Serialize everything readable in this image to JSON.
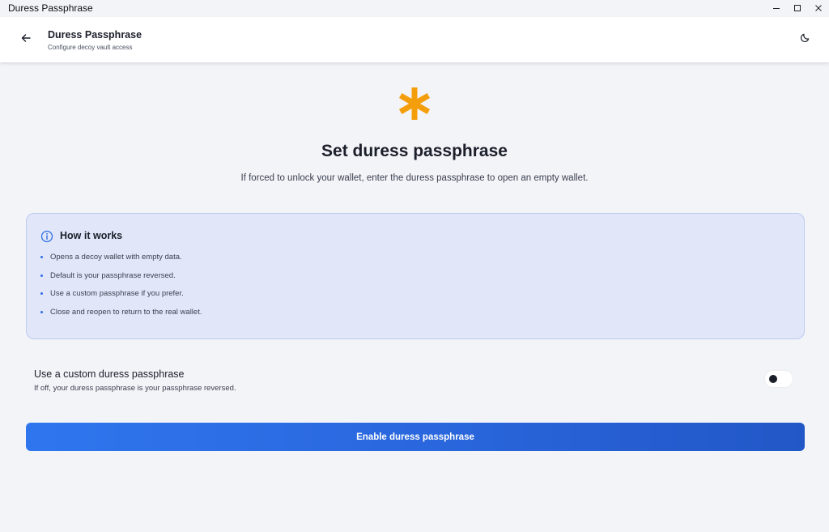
{
  "window": {
    "title": "Duress Passphrase",
    "controls": [
      "minimize",
      "maximize",
      "close"
    ]
  },
  "appbar": {
    "back_icon": "arrow-left-icon",
    "title": "Duress Passphrase",
    "subtitle": "Configure decoy vault access",
    "theme_icon": "moon-icon"
  },
  "hero": {
    "icon": "asterisk-icon",
    "icon_color": "#f59e0b",
    "heading": "Set duress passphrase",
    "description": "If forced to unlock your wallet, enter the duress passphrase to open an empty wallet."
  },
  "info": {
    "icon": "info-icon",
    "title": "How it works",
    "bullets": [
      "Opens a decoy wallet with empty data.",
      "Default is your passphrase reversed.",
      "Use a custom passphrase if you prefer.",
      "Close and reopen to return to the real wallet."
    ]
  },
  "option": {
    "label": "Use a custom duress passphrase",
    "description": "If off, your duress passphrase is your passphrase reversed.",
    "enabled": false
  },
  "cta": {
    "label": "Enable duress passphrase"
  },
  "colors": {
    "accent": "#2f6fe5",
    "info_bg": "#e1e7f8",
    "page_bg": "#f3f4f8"
  }
}
